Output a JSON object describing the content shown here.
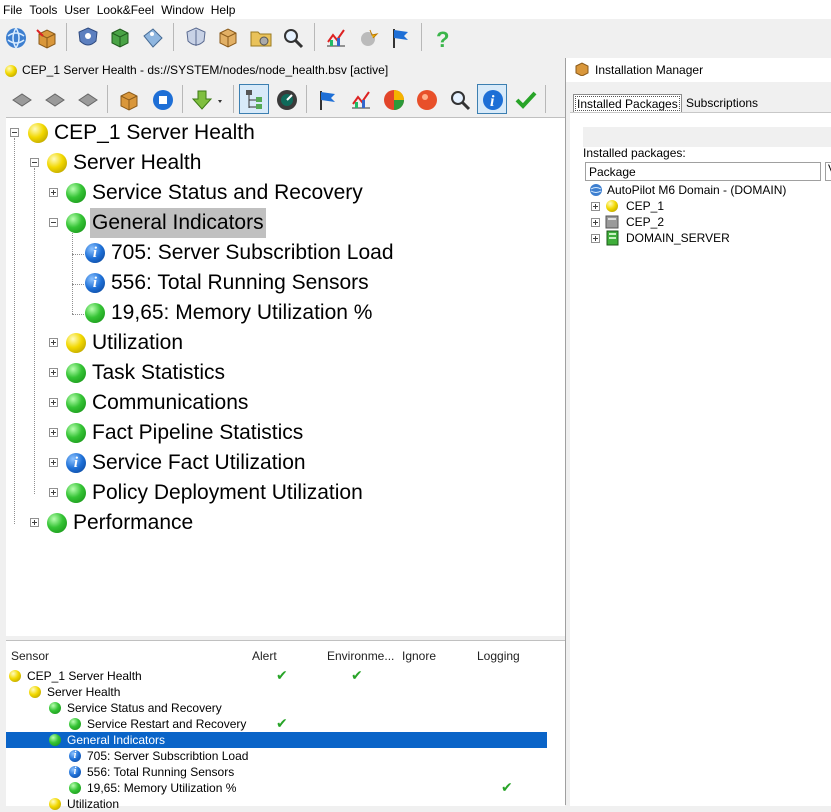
{
  "menubar": [
    "File",
    "Tools",
    "User",
    "Look&Feel",
    "Window",
    "Help"
  ],
  "document": {
    "title": "CEP_1 Server Health - ds://SYSTEM/nodes/node_health.bsv [active]"
  },
  "tree": {
    "nodes": [
      {
        "label": "CEP_1 Server Health",
        "status": "yellow"
      },
      {
        "label": "Server Health",
        "status": "yellow"
      },
      {
        "label": "Service Status and Recovery",
        "status": "green"
      },
      {
        "label": "General Indicators",
        "status": "green"
      },
      {
        "label": "705: Server Subscribtion Load",
        "status": "info"
      },
      {
        "label": "556: Total Running Sensors",
        "status": "info"
      },
      {
        "label": "19,65: Memory Utilization %",
        "status": "green"
      },
      {
        "label": "Utilization",
        "status": "yellow"
      },
      {
        "label": "Task Statistics",
        "status": "green"
      },
      {
        "label": "Communications",
        "status": "green"
      },
      {
        "label": "Fact Pipeline Statistics",
        "status": "green"
      },
      {
        "label": "Service Fact Utilization",
        "status": "info"
      },
      {
        "label": "Policy Deployment Utilization",
        "status": "green"
      },
      {
        "label": "Performance",
        "status": "green"
      }
    ]
  },
  "sensor_table": {
    "columns": [
      "Sensor",
      "Alert",
      "Environme...",
      "Ignore",
      "Logging"
    ],
    "rows": [
      {
        "label": "CEP_1 Server Health",
        "status": "yellow"
      },
      {
        "label": "Server Health",
        "status": "yellow"
      },
      {
        "label": "Service Status and Recovery",
        "status": "green"
      },
      {
        "label": "Service Restart and Recovery",
        "status": "green"
      },
      {
        "label": "General Indicators",
        "status": "green"
      },
      {
        "label": "705: Server Subscribtion Load",
        "status": "info"
      },
      {
        "label": "556: Total Running Sensors",
        "status": "info"
      },
      {
        "label": "19,65: Memory Utilization %",
        "status": "green"
      },
      {
        "label": "Utilization",
        "status": "yellow"
      }
    ]
  },
  "install_manager": {
    "title": "Installation Manager",
    "tabs": [
      "Installed Packages",
      "Subscriptions"
    ],
    "installed_label": "Installed packages:",
    "column": "Package",
    "column2": "V",
    "packages": [
      {
        "label": "AutoPilot M6 Domain - (DOMAIN)",
        "icon": "globe-icon"
      },
      {
        "label": "CEP_1",
        "icon": "yellow-status-icon"
      },
      {
        "label": "CEP_2",
        "icon": "gray-server-icon"
      },
      {
        "label": "DOMAIN_SERVER",
        "icon": "green-server-icon"
      }
    ]
  },
  "icons": {
    "main_toolbar": [
      "globe-icon",
      "package-icon",
      "user-shield-icon",
      "green-box-icon",
      "tag-icon",
      "shield-icon",
      "box-icon",
      "folder-gear-icon",
      "magnifier-icon",
      "chart-icon",
      "burst-icon",
      "flag-icon",
      "help-icon"
    ],
    "doc_toolbar": [
      "diamond-icon",
      "diamond-icon",
      "diamond-icon",
      "package-icon",
      "stop-icon",
      "down-arrow-icon",
      "tree-icon",
      "gauge-icon",
      "flag-icon",
      "chart-icon",
      "pie-icon",
      "alarm-icon",
      "magnifier-icon",
      "info-icon",
      "check-icon"
    ]
  },
  "colors": {
    "selection": "#0a64c8",
    "check": "#28a428",
    "green": "#35c435",
    "yellow": "#f2d800",
    "info": "#1d6fd6"
  }
}
